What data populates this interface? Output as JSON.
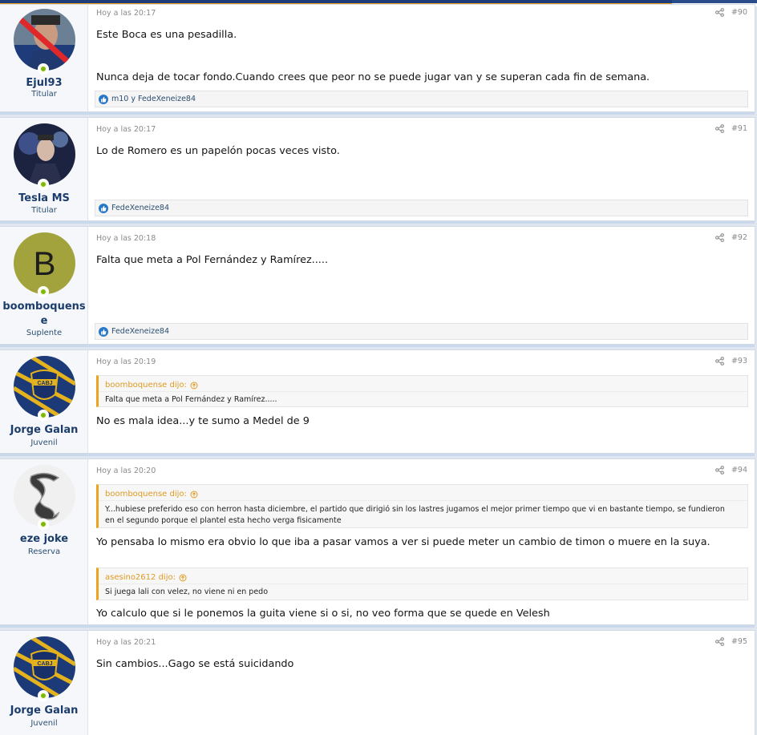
{
  "posts": [
    {
      "user": {
        "name": "Ejul93",
        "role": "Titular"
      },
      "time": "Hoy a las 20:17",
      "number": "#90",
      "lines": [
        "Este Boca es una pesadilla.",
        "Nunca deja de tocar fondo.Cuando crees que peor no se puede jugar van y se superan cada fin de semana."
      ],
      "reactions": "m10 y FedeXeneize84"
    },
    {
      "user": {
        "name": "Tesla MS",
        "role": "Titular"
      },
      "time": "Hoy a las 20:17",
      "number": "#91",
      "lines": [
        "Lo de Romero es un papelón pocas veces visto."
      ],
      "reactions": "FedeXeneize84"
    },
    {
      "user": {
        "name_line1": "boomboquens",
        "name_line2": "e",
        "role": "Suplente",
        "initial": "B"
      },
      "time": "Hoy a las 20:18",
      "number": "#92",
      "lines": [
        "Falta que meta a Pol Fernández y Ramírez....."
      ],
      "reactions": "FedeXeneize84"
    },
    {
      "user": {
        "name": "Jorge Galan",
        "role": "Juvenil"
      },
      "time": "Hoy a las 20:19",
      "number": "#93",
      "quote": {
        "author": "boomboquense dijo:",
        "text": "Falta que meta a Pol Fernández y Ramírez....."
      },
      "lines": [
        "No es mala idea...y te sumo a Medel de 9"
      ]
    },
    {
      "user": {
        "name": "eze joke",
        "role": "Reserva"
      },
      "time": "Hoy a las 20:20",
      "number": "#94",
      "quote": {
        "author": "boomboquense dijo:",
        "text1": "Y...hubiese preferido eso con herron hasta diciembre, el partido que dirigió sin los lastres jugamos el mejor primer tiempo que vi en bastante tiempo, se fundieron",
        "text2": "en el segundo porque el plantel esta hecho verga fisicamente"
      },
      "lines": [
        "Yo pensaba lo mismo era obvio lo que iba a pasar vamos a ver si puede meter un cambio de timon o muere en la suya."
      ],
      "quote2": {
        "author": "asesino2612 dijo:",
        "text": "Si juega lali con velez, no viene ni en pedo"
      },
      "lines2": [
        "Yo calculo que si le ponemos la guita viene si o si, no veo forma que se quede en Velesh"
      ]
    },
    {
      "user": {
        "name": "Jorge Galan",
        "role": "Juvenil"
      },
      "time": "Hoy a las 20:21",
      "number": "#95",
      "lines": [
        "Sin cambios...Gago se está suicidando"
      ]
    }
  ],
  "colors": {
    "accent": "#f0a21c",
    "brand": "#1e3d7a",
    "online": "#7fb900",
    "username": "#1c3d6c"
  }
}
